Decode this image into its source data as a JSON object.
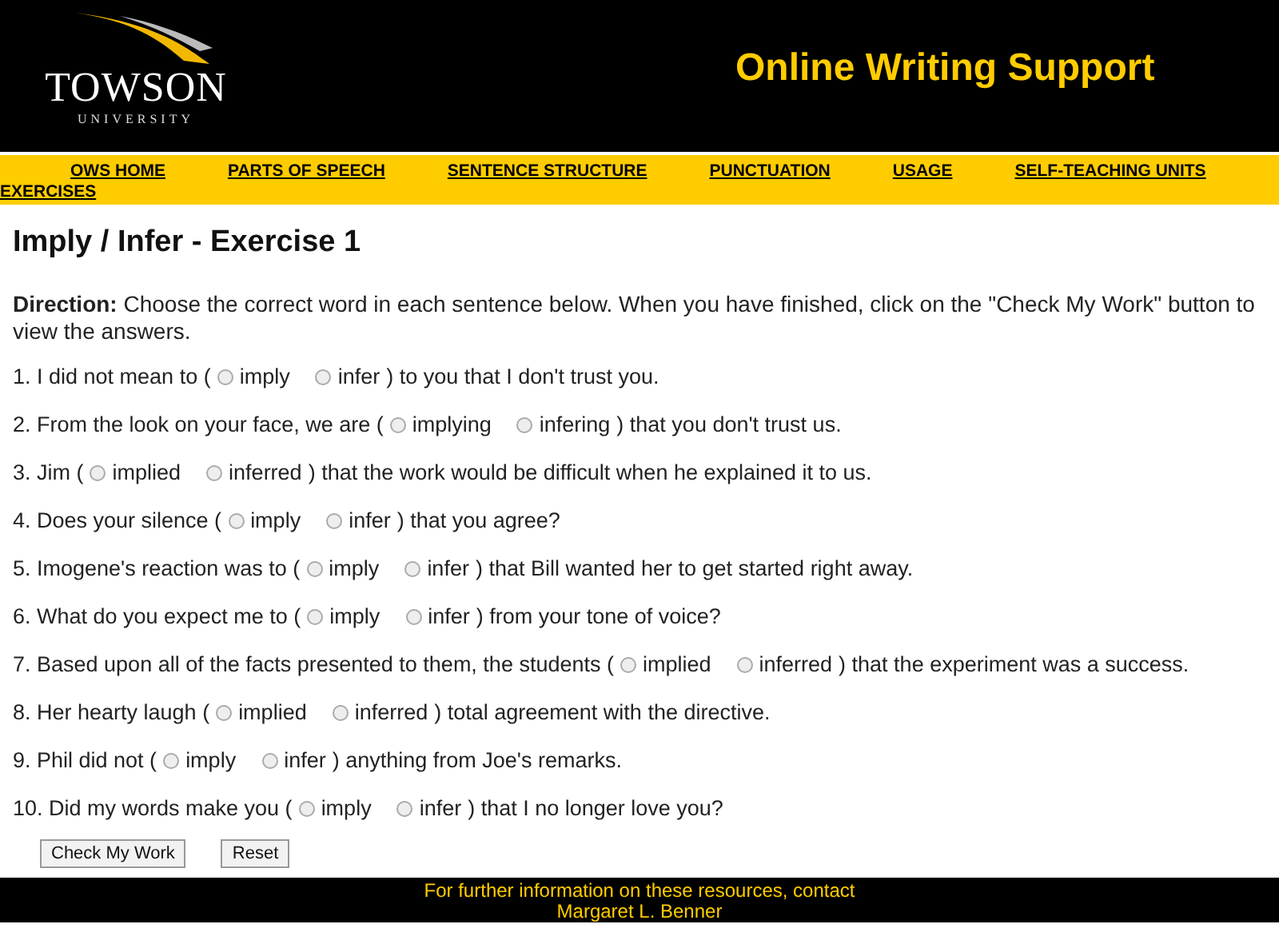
{
  "header": {
    "logo_name": "TOWSON",
    "logo_sub": "UNIVERSITY",
    "site_title": "Online Writing Support"
  },
  "nav": [
    "OWS HOME",
    "PARTS OF SPEECH",
    "SENTENCE STRUCTURE",
    "PUNCTUATION",
    "USAGE",
    "SELF-TEACHING UNITS",
    "EXERCISES"
  ],
  "page_title": "Imply / Infer - Exercise 1",
  "direction": "**Direction:** Choose the correct word in each sentence below. When you have finished, click on the \"Check My Work\" button to view the answers.",
  "questions": [
    {
      "before": "1. I did not mean to (",
      "options": [
        {
          "label": "imply",
          "selected": false
        },
        {
          "label": "infer",
          "selected": false
        }
      ],
      "after": ") to you that I don't trust you."
    },
    {
      "before": "2. From the look on your face, we are (",
      "options": [
        {
          "label": "implying",
          "selected": false
        },
        {
          "label": "infering",
          "selected": false
        }
      ],
      "after": ") that you don't trust us."
    },
    {
      "before": "3. Jim (",
      "options": [
        {
          "label": "implied",
          "selected": false
        },
        {
          "label": "inferred",
          "selected": false
        }
      ],
      "after": ") that the work would be difficult when he explained it to us."
    },
    {
      "before": "4. Does your silence (",
      "options": [
        {
          "label": "imply",
          "selected": false
        },
        {
          "label": "infer",
          "selected": false
        }
      ],
      "after": ") that you agree?"
    },
    {
      "before": "5. Imogene's reaction was to (",
      "options": [
        {
          "label": "imply",
          "selected": false
        },
        {
          "label": "infer",
          "selected": false
        }
      ],
      "after": ") that Bill wanted her to get started right away."
    },
    {
      "before": "6. What do you expect me to (",
      "options": [
        {
          "label": "imply",
          "selected": false
        },
        {
          "label": "infer",
          "selected": false
        }
      ],
      "after": ") from your tone of voice?"
    },
    {
      "before": "7. Based upon all of the facts presented to them, the students (",
      "options": [
        {
          "label": "implied",
          "selected": false
        },
        {
          "label": "inferred",
          "selected": false
        }
      ],
      "after": ") that the experiment was a success."
    },
    {
      "before": "8. Her hearty laugh (",
      "options": [
        {
          "label": "implied",
          "selected": false
        },
        {
          "label": "inferred",
          "selected": false
        }
      ],
      "after": ") total agreement with the directive."
    },
    {
      "before": "9. Phil did not (",
      "options": [
        {
          "label": "imply",
          "selected": false
        },
        {
          "label": "infer",
          "selected": false
        }
      ],
      "after": ") anything from Joe's remarks."
    },
    {
      "before": "10. Did my words make you (",
      "options": [
        {
          "label": "imply",
          "selected": false
        },
        {
          "label": "infer",
          "selected": false
        }
      ],
      "after": ") that I no longer love you?"
    }
  ],
  "buttons": [
    "Check My Work",
    "Reset"
  ],
  "footer": [
    "For further information on these resources, contact",
    "Margaret L. Benner"
  ]
}
